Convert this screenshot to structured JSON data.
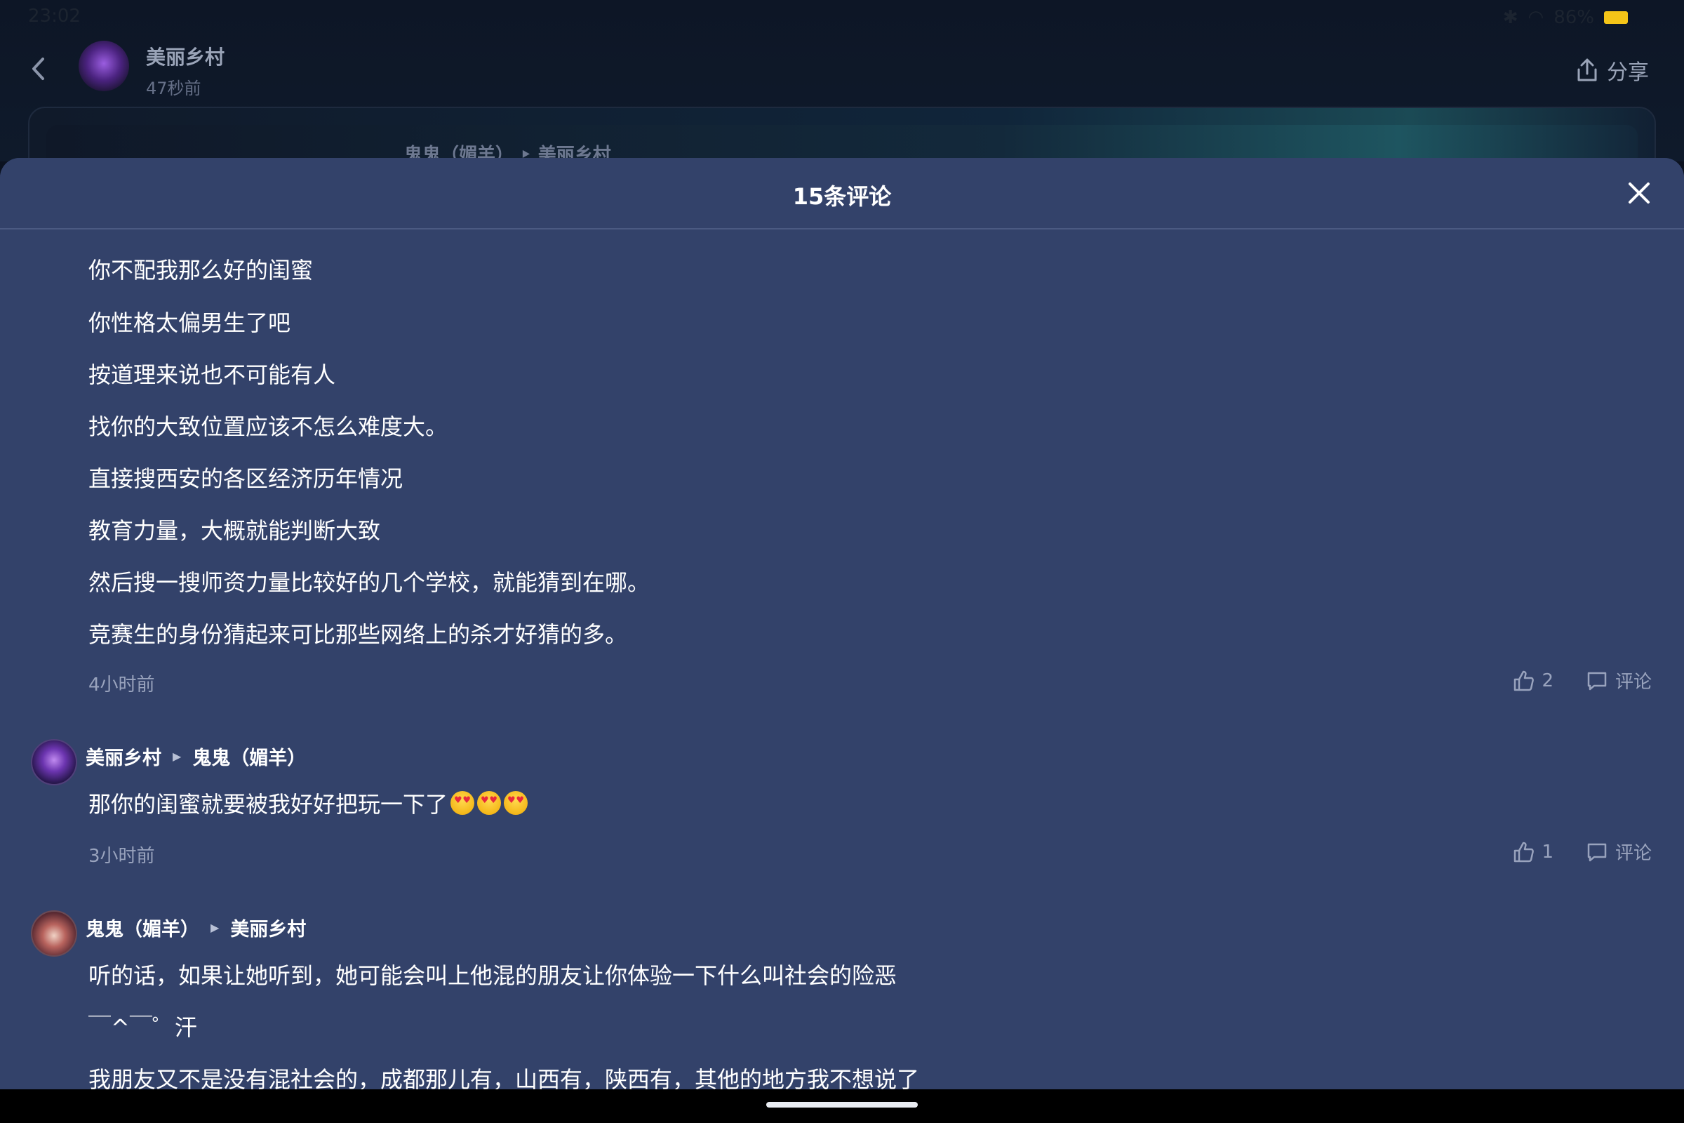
{
  "status_bar": {
    "time": "23:02",
    "battery": "86%"
  },
  "post": {
    "author": "美丽乡村",
    "time": "47秒前",
    "share_label": "分享",
    "preview_from": "鬼鬼（媚羊）",
    "preview_to": "美丽乡村"
  },
  "sheet": {
    "title": "15条评论"
  },
  "comments": [
    {
      "lines": [
        "你不配我那么好的闺蜜",
        "你性格太偏男生了吧",
        "按道理来说也不可能有人",
        "找你的大致位置应该不怎么难度大。",
        "直接搜西安的各区经济历年情况",
        "教育力量，大概就能判断大致",
        "然后搜一搜师资力量比较好的几个学校，就能猜到在哪。",
        "竞赛生的身份猜起来可比那些网络上的杀才好猜的多。"
      ],
      "time": "4小时前",
      "likes": "2",
      "reply_label": "评论"
    },
    {
      "from": "美丽乡村",
      "to": "鬼鬼（媚羊）",
      "text": "那你的闺蜜就要被我好好把玩一下了",
      "emoji_count": 3,
      "time": "3小时前",
      "likes": "1",
      "reply_label": "评论"
    },
    {
      "from": "鬼鬼（媚羊）",
      "to": "美丽乡村",
      "lines": [
        "听的话，如果让她听到，她可能会叫上他混的朋友让你体验一下什么叫社会的险恶",
        "￣^￣゜汗",
        "我朋友又不是没有混社会的，成都那儿有，山西有，陕西有，其他的地方我不想说了"
      ]
    }
  ]
}
